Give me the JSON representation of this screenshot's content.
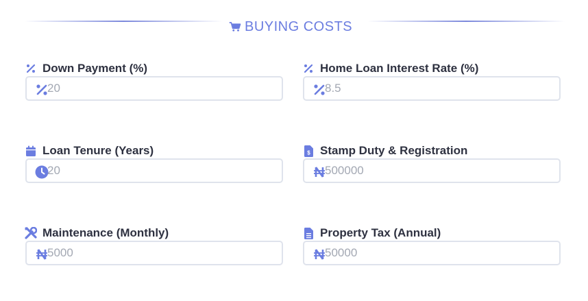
{
  "section": {
    "title": "BUYING COSTS",
    "icon": "cart-icon"
  },
  "colors": {
    "accent": "#6b7de0",
    "label": "#2e3140",
    "border": "#dfe3ec",
    "placeholder": "#a3a8b3"
  },
  "fields": {
    "down_payment": {
      "label": "Down Payment (%)",
      "icon": "percent-icon",
      "prefix_icon": "percent-icon",
      "placeholder": "20"
    },
    "interest_rate": {
      "label": "Home Loan Interest Rate (%)",
      "icon": "percent-icon",
      "prefix_icon": "percent-icon",
      "placeholder": "8.5"
    },
    "loan_tenure": {
      "label": "Loan Tenure (Years)",
      "icon": "calendar-icon",
      "prefix_icon": "clock-icon",
      "placeholder": "20"
    },
    "stamp_duty": {
      "label": "Stamp Duty & Registration",
      "icon": "invoice-icon",
      "prefix_icon": "naira-icon",
      "placeholder": "500000"
    },
    "maintenance": {
      "label": "Maintenance (Monthly)",
      "icon": "tools-icon",
      "prefix_icon": "naira-icon",
      "placeholder": "5000"
    },
    "property_tax": {
      "label": "Property Tax (Annual)",
      "icon": "document-icon",
      "prefix_icon": "naira-icon",
      "placeholder": "50000"
    }
  }
}
